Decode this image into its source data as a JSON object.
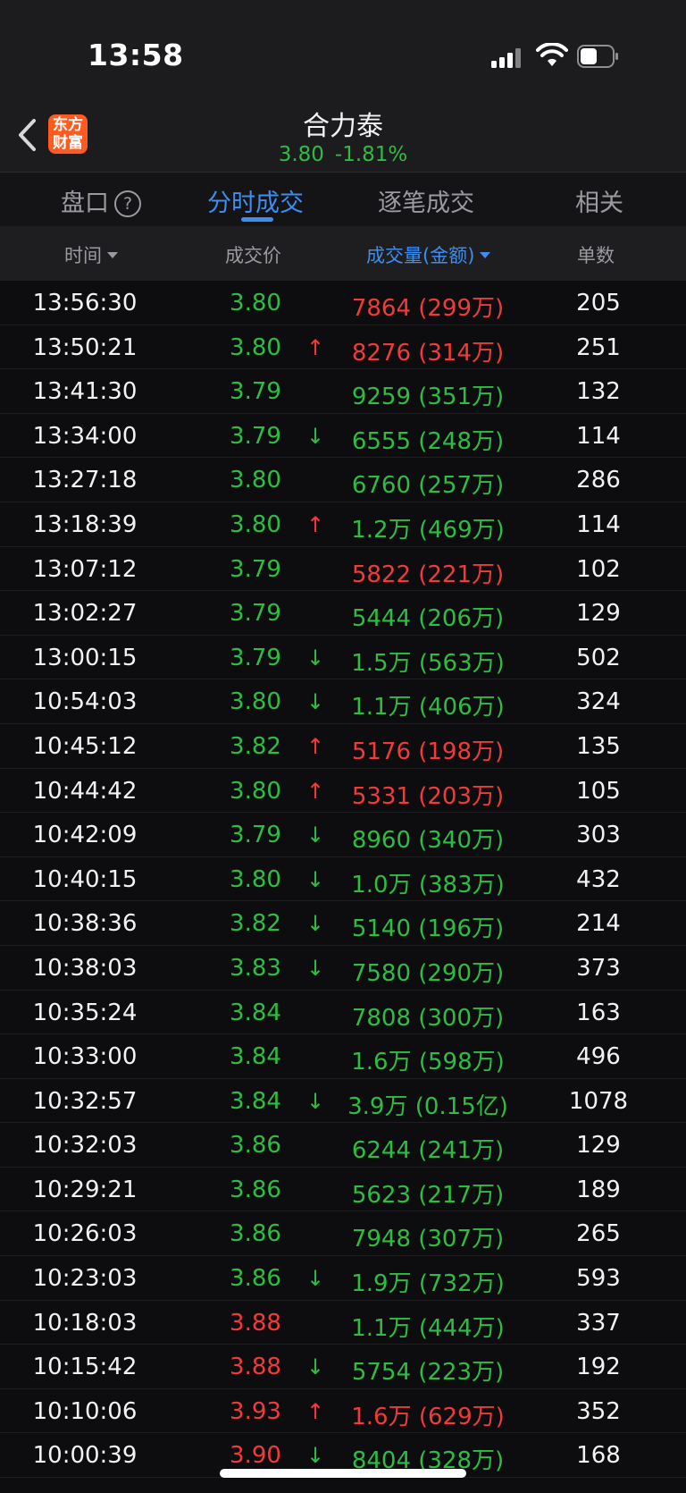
{
  "status_bar": {
    "time": "13:58"
  },
  "header": {
    "logo_line1": "东方",
    "logo_line2": "财富",
    "title": "合力泰",
    "price": "3.80",
    "change": "-1.81%"
  },
  "tabs": [
    {
      "label": "盘口",
      "active": false,
      "has_help": true
    },
    {
      "label": "分时成交",
      "active": true
    },
    {
      "label": "逐笔成交",
      "active": false
    },
    {
      "label": "相关",
      "active": false
    }
  ],
  "columns": {
    "time": "时间",
    "price": "成交价",
    "volume": "成交量(金额)",
    "count": "单数"
  },
  "colors": {
    "up": "#f23a3a",
    "down": "#2ebd43",
    "accent": "#3d8ef0"
  },
  "rows": [
    {
      "time": "13:56:30",
      "price": "3.80",
      "price_color": "green",
      "arrow": "",
      "arrow_color": "",
      "volume": "7864 (299万)",
      "volume_color": "red",
      "count": "205"
    },
    {
      "time": "13:50:21",
      "price": "3.80",
      "price_color": "green",
      "arrow": "↑",
      "arrow_color": "red",
      "volume": "8276 (314万)",
      "volume_color": "red",
      "count": "251"
    },
    {
      "time": "13:41:30",
      "price": "3.79",
      "price_color": "green",
      "arrow": "",
      "arrow_color": "",
      "volume": "9259 (351万)",
      "volume_color": "green",
      "count": "132"
    },
    {
      "time": "13:34:00",
      "price": "3.79",
      "price_color": "green",
      "arrow": "↓",
      "arrow_color": "green",
      "volume": "6555 (248万)",
      "volume_color": "green",
      "count": "114"
    },
    {
      "time": "13:27:18",
      "price": "3.80",
      "price_color": "green",
      "arrow": "",
      "arrow_color": "",
      "volume": "6760 (257万)",
      "volume_color": "green",
      "count": "286"
    },
    {
      "time": "13:18:39",
      "price": "3.80",
      "price_color": "green",
      "arrow": "↑",
      "arrow_color": "red",
      "volume": "1.2万 (469万)",
      "volume_color": "green",
      "count": "114"
    },
    {
      "time": "13:07:12",
      "price": "3.79",
      "price_color": "green",
      "arrow": "",
      "arrow_color": "",
      "volume": "5822 (221万)",
      "volume_color": "red",
      "count": "102"
    },
    {
      "time": "13:02:27",
      "price": "3.79",
      "price_color": "green",
      "arrow": "",
      "arrow_color": "",
      "volume": "5444 (206万)",
      "volume_color": "green",
      "count": "129"
    },
    {
      "time": "13:00:15",
      "price": "3.79",
      "price_color": "green",
      "arrow": "↓",
      "arrow_color": "green",
      "volume": "1.5万 (563万)",
      "volume_color": "green",
      "count": "502"
    },
    {
      "time": "10:54:03",
      "price": "3.80",
      "price_color": "green",
      "arrow": "↓",
      "arrow_color": "green",
      "volume": "1.1万 (406万)",
      "volume_color": "green",
      "count": "324"
    },
    {
      "time": "10:45:12",
      "price": "3.82",
      "price_color": "green",
      "arrow": "↑",
      "arrow_color": "red",
      "volume": "5176 (198万)",
      "volume_color": "red",
      "count": "135"
    },
    {
      "time": "10:44:42",
      "price": "3.80",
      "price_color": "green",
      "arrow": "↑",
      "arrow_color": "red",
      "volume": "5331 (203万)",
      "volume_color": "red",
      "count": "105"
    },
    {
      "time": "10:42:09",
      "price": "3.79",
      "price_color": "green",
      "arrow": "↓",
      "arrow_color": "green",
      "volume": "8960 (340万)",
      "volume_color": "green",
      "count": "303"
    },
    {
      "time": "10:40:15",
      "price": "3.80",
      "price_color": "green",
      "arrow": "↓",
      "arrow_color": "green",
      "volume": "1.0万 (383万)",
      "volume_color": "green",
      "count": "432"
    },
    {
      "time": "10:38:36",
      "price": "3.82",
      "price_color": "green",
      "arrow": "↓",
      "arrow_color": "green",
      "volume": "5140 (196万)",
      "volume_color": "green",
      "count": "214"
    },
    {
      "time": "10:38:03",
      "price": "3.83",
      "price_color": "green",
      "arrow": "↓",
      "arrow_color": "green",
      "volume": "7580 (290万)",
      "volume_color": "green",
      "count": "373"
    },
    {
      "time": "10:35:24",
      "price": "3.84",
      "price_color": "green",
      "arrow": "",
      "arrow_color": "",
      "volume": "7808 (300万)",
      "volume_color": "green",
      "count": "163"
    },
    {
      "time": "10:33:00",
      "price": "3.84",
      "price_color": "green",
      "arrow": "",
      "arrow_color": "",
      "volume": "1.6万 (598万)",
      "volume_color": "green",
      "count": "496"
    },
    {
      "time": "10:32:57",
      "price": "3.84",
      "price_color": "green",
      "arrow": "↓",
      "arrow_color": "green",
      "volume": "3.9万 (0.15亿)",
      "volume_color": "green",
      "count": "1078"
    },
    {
      "time": "10:32:03",
      "price": "3.86",
      "price_color": "green",
      "arrow": "",
      "arrow_color": "",
      "volume": "6244 (241万)",
      "volume_color": "green",
      "count": "129"
    },
    {
      "time": "10:29:21",
      "price": "3.86",
      "price_color": "green",
      "arrow": "",
      "arrow_color": "",
      "volume": "5623 (217万)",
      "volume_color": "green",
      "count": "189"
    },
    {
      "time": "10:26:03",
      "price": "3.86",
      "price_color": "green",
      "arrow": "",
      "arrow_color": "",
      "volume": "7948 (307万)",
      "volume_color": "green",
      "count": "265"
    },
    {
      "time": "10:23:03",
      "price": "3.86",
      "price_color": "green",
      "arrow": "↓",
      "arrow_color": "green",
      "volume": "1.9万 (732万)",
      "volume_color": "green",
      "count": "593"
    },
    {
      "time": "10:18:03",
      "price": "3.88",
      "price_color": "red",
      "arrow": "",
      "arrow_color": "",
      "volume": "1.1万 (444万)",
      "volume_color": "green",
      "count": "337"
    },
    {
      "time": "10:15:42",
      "price": "3.88",
      "price_color": "red",
      "arrow": "↓",
      "arrow_color": "green",
      "volume": "5754 (223万)",
      "volume_color": "green",
      "count": "192"
    },
    {
      "time": "10:10:06",
      "price": "3.93",
      "price_color": "red",
      "arrow": "↑",
      "arrow_color": "red",
      "volume": "1.6万 (629万)",
      "volume_color": "red",
      "count": "352"
    },
    {
      "time": "10:00:39",
      "price": "3.90",
      "price_color": "red",
      "arrow": "↓",
      "arrow_color": "green",
      "volume": "8404 (328万)",
      "volume_color": "green",
      "count": "168"
    }
  ]
}
